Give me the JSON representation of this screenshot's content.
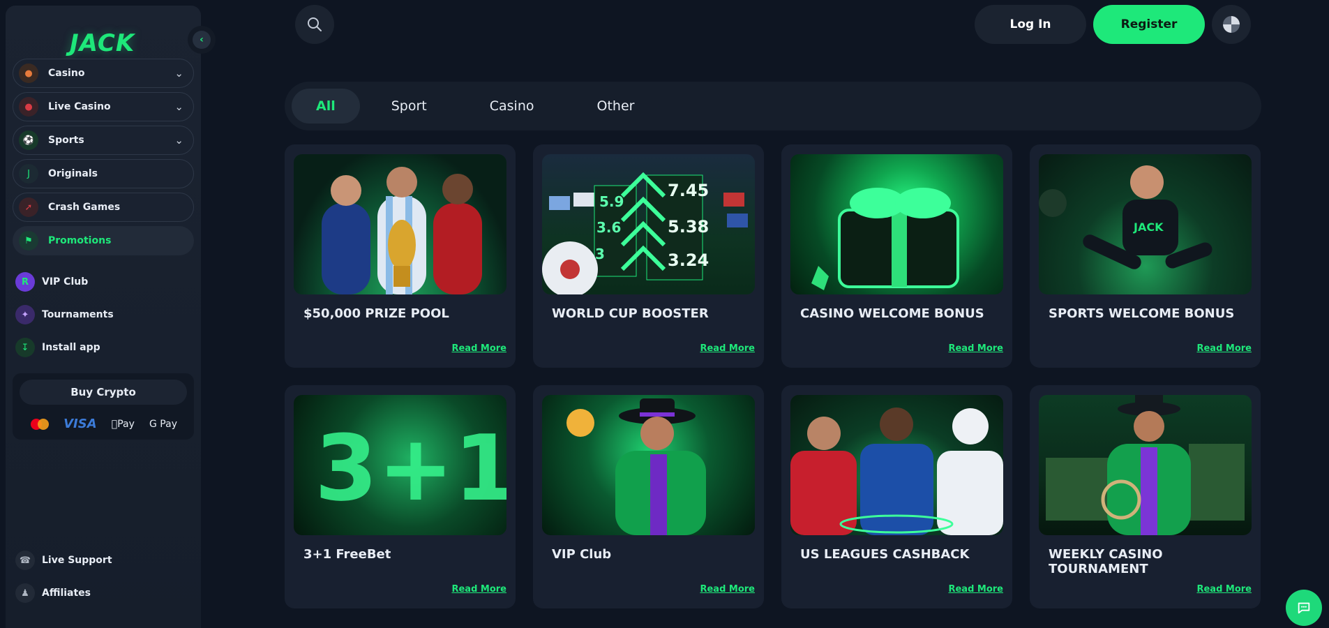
{
  "brand": {
    "logo": "JACK",
    "accent": "#1ee87a"
  },
  "sidebar": {
    "collapse_icon": "chevron-left-icon",
    "items": [
      {
        "label": "Casino",
        "icon": "casino-icon",
        "expandable": true,
        "color": "#e77b3c"
      },
      {
        "label": "Live Casino",
        "icon": "live-casino-icon",
        "expandable": true,
        "color": "#d93b45"
      },
      {
        "label": "Sports",
        "icon": "sports-icon",
        "expandable": true,
        "color": "#1ee87a"
      },
      {
        "label": "Originals",
        "icon": "originals-icon",
        "expandable": false,
        "color": "#1ee87a"
      },
      {
        "label": "Crash Games",
        "icon": "crash-games-icon",
        "expandable": false,
        "color": "#d93b45"
      },
      {
        "label": "Promotions",
        "icon": "promotions-icon",
        "expandable": false,
        "active": true,
        "color": "#1ee87a"
      }
    ],
    "plain_items": [
      {
        "label": "VIP Club",
        "icon": "vip-club-icon"
      },
      {
        "label": "Tournaments",
        "icon": "tournaments-icon"
      },
      {
        "label": "Install app",
        "icon": "install-app-icon"
      }
    ],
    "buy_crypto": {
      "label": "Buy Crypto",
      "payments": [
        "Mastercard",
        "VISA",
        "Pay",
        "G Pay"
      ]
    },
    "bottom_items": [
      {
        "label": "Live Support",
        "icon": "headset-icon"
      },
      {
        "label": "Affiliates",
        "icon": "affiliates-icon"
      }
    ]
  },
  "header": {
    "search_icon": "search-icon",
    "login_label": "Log In",
    "register_label": "Register",
    "language_icon": "globe-icon"
  },
  "tabs": [
    {
      "label": "All",
      "active": true
    },
    {
      "label": "Sport"
    },
    {
      "label": "Casino"
    },
    {
      "label": "Other"
    }
  ],
  "promotions": [
    {
      "title": "$50,000 PRIZE POOL",
      "read_more": "Read More",
      "theme": "stadium"
    },
    {
      "title": "WORLD CUP BOOSTER",
      "read_more": "Read More",
      "theme": "odds"
    },
    {
      "title": "CASINO WELCOME BONUS",
      "read_more": "Read More",
      "theme": "gift"
    },
    {
      "title": "SPORTS WELCOME BONUS",
      "read_more": "Read More",
      "theme": "stadium"
    },
    {
      "title": "3+1 FreeBet",
      "read_more": "Read More",
      "theme": "neon"
    },
    {
      "title": "VIP Club",
      "read_more": "Read More",
      "theme": "neon"
    },
    {
      "title": "US LEAGUES CASHBACK",
      "read_more": "Read More",
      "theme": "sports"
    },
    {
      "title": "WEEKLY CASINO TOURNAMENT",
      "read_more": "Read More",
      "theme": "forest"
    }
  ],
  "odds_banner": [
    "5.9",
    "7.45",
    "3.6",
    "5.38",
    "3",
    "3.24"
  ],
  "chat_icon": "chat-bubble-icon"
}
